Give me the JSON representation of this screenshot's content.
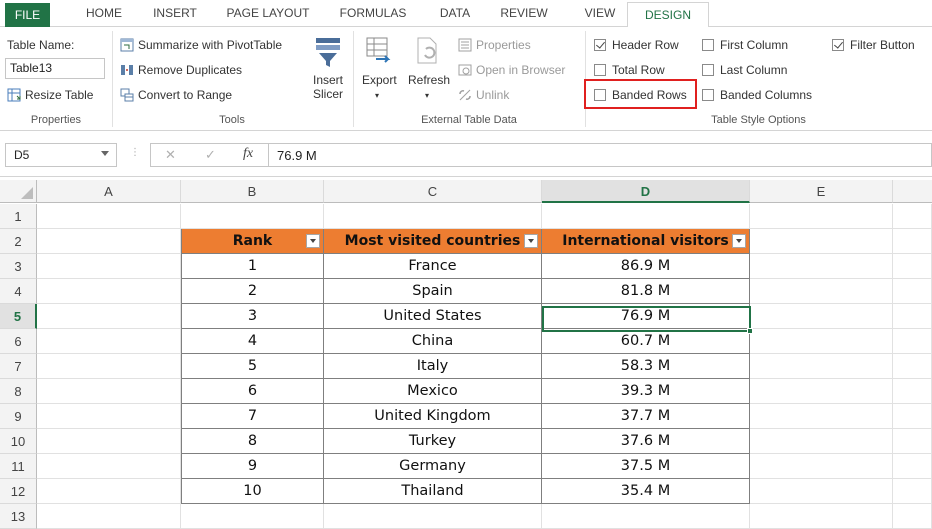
{
  "ribbon_tabs": [
    "FILE",
    "HOME",
    "INSERT",
    "PAGE LAYOUT",
    "FORMULAS",
    "DATA",
    "REVIEW",
    "VIEW",
    "DESIGN"
  ],
  "active_tab": "DESIGN",
  "properties": {
    "table_name_label": "Table Name:",
    "table_name_value": "Table13",
    "resize_label": "Resize Table",
    "group_label": "Properties"
  },
  "tools": {
    "summarize": "Summarize with PivotTable",
    "remove_duplicates": "Remove Duplicates",
    "convert_range": "Convert to Range",
    "insert_slicer_1": "Insert",
    "insert_slicer_2": "Slicer",
    "group_label": "Tools"
  },
  "external": {
    "export": "Export",
    "refresh": "Refresh",
    "properties": "Properties",
    "open_browser": "Open in Browser",
    "unlink": "Unlink",
    "group_label": "External Table Data"
  },
  "style_options": {
    "header_row": {
      "label": "Header Row",
      "checked": true
    },
    "total_row": {
      "label": "Total Row",
      "checked": false
    },
    "banded_rows": {
      "label": "Banded Rows",
      "checked": false
    },
    "first_column": {
      "label": "First Column",
      "checked": false
    },
    "last_column": {
      "label": "Last Column",
      "checked": false
    },
    "banded_columns": {
      "label": "Banded Columns",
      "checked": false
    },
    "filter_button": {
      "label": "Filter Button",
      "checked": true
    },
    "group_label": "Table Style Options"
  },
  "formula_bar": {
    "cell_ref": "D5",
    "cancel_symbol": "✕",
    "enter_symbol": "✓",
    "fx_symbol": "fx",
    "content": "76.9 M"
  },
  "grid": {
    "columns": [
      "A",
      "B",
      "C",
      "D",
      "E"
    ],
    "selected_column": "D",
    "rows": [
      "1",
      "2",
      "3",
      "4",
      "5",
      "6",
      "7",
      "8",
      "9",
      "10",
      "11",
      "12",
      "13"
    ],
    "selected_row": "5"
  },
  "table": {
    "headers": [
      "Rank",
      "Most visited countries",
      "International visitors"
    ],
    "header_color": "#ed7d31",
    "rows": [
      [
        "1",
        "France",
        "86.9 M"
      ],
      [
        "2",
        "Spain",
        "81.8 M"
      ],
      [
        "3",
        "United States",
        "76.9 M"
      ],
      [
        "4",
        "China",
        "60.7 M"
      ],
      [
        "5",
        "Italy",
        "58.3 M"
      ],
      [
        "6",
        "Mexico",
        "39.3 M"
      ],
      [
        "7",
        "United Kingdom",
        "37.7 M"
      ],
      [
        "8",
        "Turkey",
        "37.6 M"
      ],
      [
        "9",
        "Germany",
        "37.5 M"
      ],
      [
        "10",
        "Thailand",
        "35.4 M"
      ]
    ]
  },
  "colors": {
    "accent": "#217346",
    "highlight_box": "#e0201f"
  }
}
